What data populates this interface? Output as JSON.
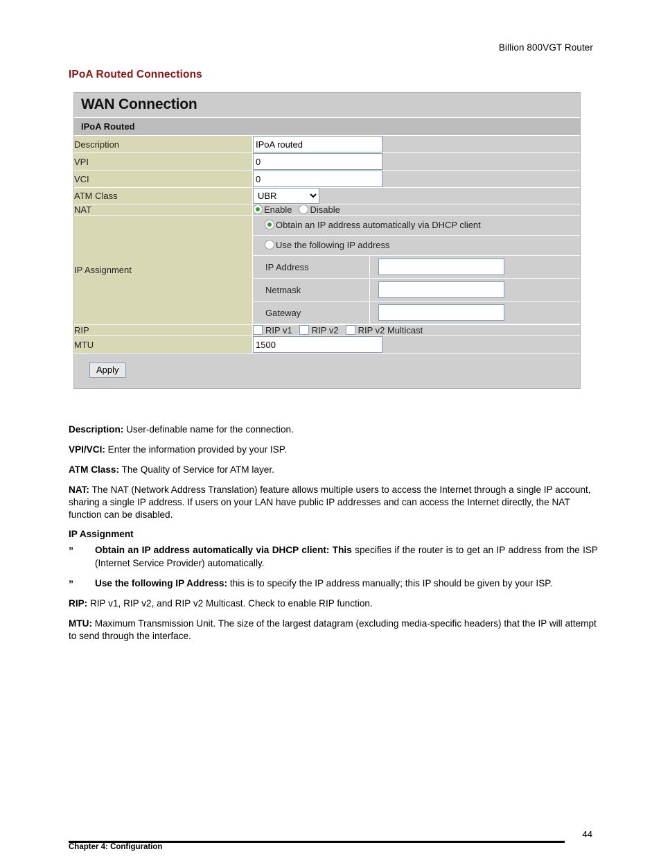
{
  "document": {
    "running_head": "Billion 800VGT Router",
    "section_heading": "IPoA Routed Connections",
    "page_number": "44",
    "footer_text": "Chapter 4: Configuration"
  },
  "panel": {
    "title": "WAN Connection",
    "subtitle": "IPoA Routed",
    "rows": {
      "description": {
        "label": "Description",
        "value": "IPoA routed"
      },
      "vpi": {
        "label": "VPI",
        "value": "0"
      },
      "vci": {
        "label": "VCI",
        "value": "0"
      },
      "atm_class": {
        "label": "ATM Class",
        "value": "UBR",
        "options": [
          "UBR"
        ]
      },
      "nat": {
        "label": "NAT",
        "enable_label": "Enable",
        "disable_label": "Disable",
        "selected": "Enable"
      },
      "ip_assignment": {
        "label": "IP Assignment",
        "option_dhcp": "Obtain an IP address automatically via DHCP client",
        "option_static": "Use the following IP address",
        "selected": "dhcp",
        "ip_address": {
          "label": "IP Address",
          "value": ""
        },
        "netmask": {
          "label": "Netmask",
          "value": ""
        },
        "gateway": {
          "label": "Gateway",
          "value": ""
        }
      },
      "rip": {
        "label": "RIP",
        "v1_label": "RIP v1",
        "v2_label": "RIP v2",
        "v2m_label": "RIP v2 Multicast",
        "v1_checked": false,
        "v2_checked": false,
        "v2m_checked": false
      },
      "mtu": {
        "label": "MTU",
        "value": "1500"
      }
    },
    "apply_label": "Apply"
  },
  "body": {
    "description": {
      "term": "Description:",
      "text": " User-definable name for the connection."
    },
    "vpivci": {
      "term": "VPI/VCI:",
      "text": " Enter the information provided by your ISP."
    },
    "atm_class": {
      "term": "ATM Class:",
      "text": " The Quality of Service for ATM layer."
    },
    "nat": {
      "term": "NAT:",
      "text": " The NAT (Network Address Translation) feature allows multiple users to access the Internet through a single IP account, sharing a single IP address. If users on your LAN have public IP addresses and can access the Internet directly, the NAT function can be disabled."
    },
    "ip_assignment_head": "IP Assignment",
    "bullet_marker": "”",
    "bullet_dhcp": {
      "term": "Obtain an IP address automatically via DHCP client: This",
      "text": " specifies if the router is to get an IP address from the ISP (Internet Service Provider) automatically."
    },
    "bullet_static": {
      "term": "Use the following IP Address:",
      "text": " this is to specify the IP address manually; this IP should be given by your ISP."
    },
    "rip": {
      "term": "RIP:",
      "text": " RIP v1, RIP v2, and RIP v2 Multicast. Check to enable RIP function."
    },
    "mtu": {
      "term": "MTU:",
      "text": " Maximum Transmission Unit. The size of the largest datagram (excluding media-specific headers) that the IP will attempt to send through the interface."
    }
  }
}
